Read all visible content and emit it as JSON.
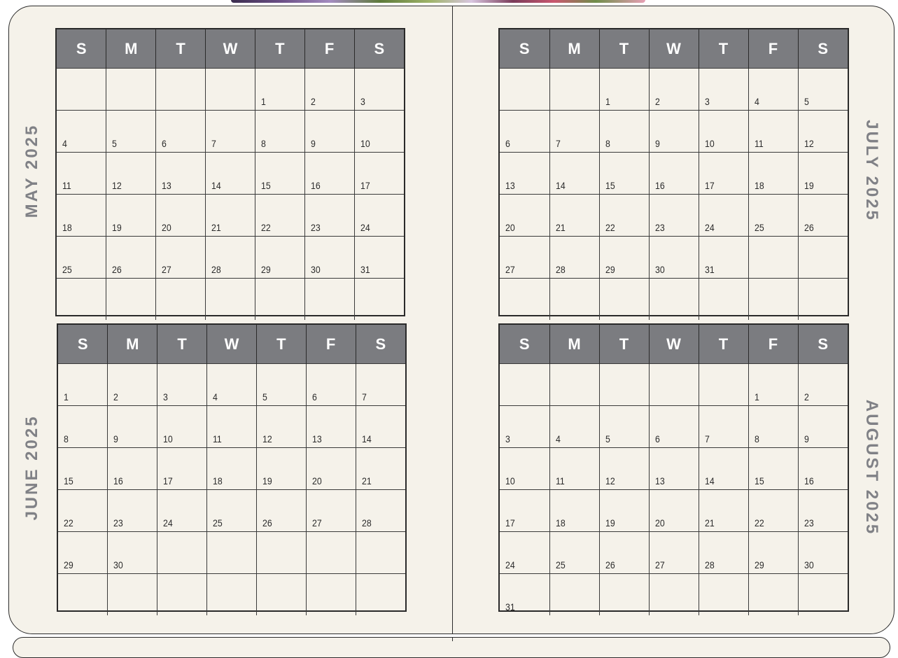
{
  "day_headers": [
    "S",
    "M",
    "T",
    "W",
    "T",
    "F",
    "S"
  ],
  "months": [
    {
      "id": "may",
      "title": "MAY 2025",
      "weeks": [
        [
          "",
          "",
          "",
          "",
          "1",
          "2",
          "3"
        ],
        [
          "4",
          "5",
          "6",
          "7",
          "8",
          "9",
          "10"
        ],
        [
          "11",
          "12",
          "13",
          "14",
          "15",
          "16",
          "17"
        ],
        [
          "18",
          "19",
          "20",
          "21",
          "22",
          "23",
          "24"
        ],
        [
          "25",
          "26",
          "27",
          "28",
          "29",
          "30",
          "31"
        ],
        [
          "",
          "",
          "",
          "",
          "",
          "",
          ""
        ]
      ]
    },
    {
      "id": "june",
      "title": "JUNE 2025",
      "weeks": [
        [
          "1",
          "2",
          "3",
          "4",
          "5",
          "6",
          "7"
        ],
        [
          "8",
          "9",
          "10",
          "11",
          "12",
          "13",
          "14"
        ],
        [
          "15",
          "16",
          "17",
          "18",
          "19",
          "20",
          "21"
        ],
        [
          "22",
          "23",
          "24",
          "25",
          "26",
          "27",
          "28"
        ],
        [
          "29",
          "30",
          "",
          "",
          "",
          "",
          ""
        ],
        [
          "",
          "",
          "",
          "",
          "",
          "",
          ""
        ]
      ]
    },
    {
      "id": "july",
      "title": "JULY 2025",
      "weeks": [
        [
          "",
          "",
          "1",
          "2",
          "3",
          "4",
          "5"
        ],
        [
          "6",
          "7",
          "8",
          "9",
          "10",
          "11",
          "12"
        ],
        [
          "13",
          "14",
          "15",
          "16",
          "17",
          "18",
          "19"
        ],
        [
          "20",
          "21",
          "22",
          "23",
          "24",
          "25",
          "26"
        ],
        [
          "27",
          "28",
          "29",
          "30",
          "31",
          "",
          ""
        ],
        [
          "",
          "",
          "",
          "",
          "",
          "",
          ""
        ]
      ]
    },
    {
      "id": "august",
      "title": "AUGUST 2025",
      "weeks": [
        [
          "",
          "",
          "",
          "",
          "",
          "1",
          "2"
        ],
        [
          "3",
          "4",
          "5",
          "6",
          "7",
          "8",
          "9"
        ],
        [
          "10",
          "11",
          "12",
          "13",
          "14",
          "15",
          "16"
        ],
        [
          "17",
          "18",
          "19",
          "20",
          "21",
          "22",
          "23"
        ],
        [
          "24",
          "25",
          "26",
          "27",
          "28",
          "29",
          "30"
        ],
        [
          "31",
          "",
          "",
          "",
          "",
          "",
          ""
        ]
      ]
    }
  ]
}
